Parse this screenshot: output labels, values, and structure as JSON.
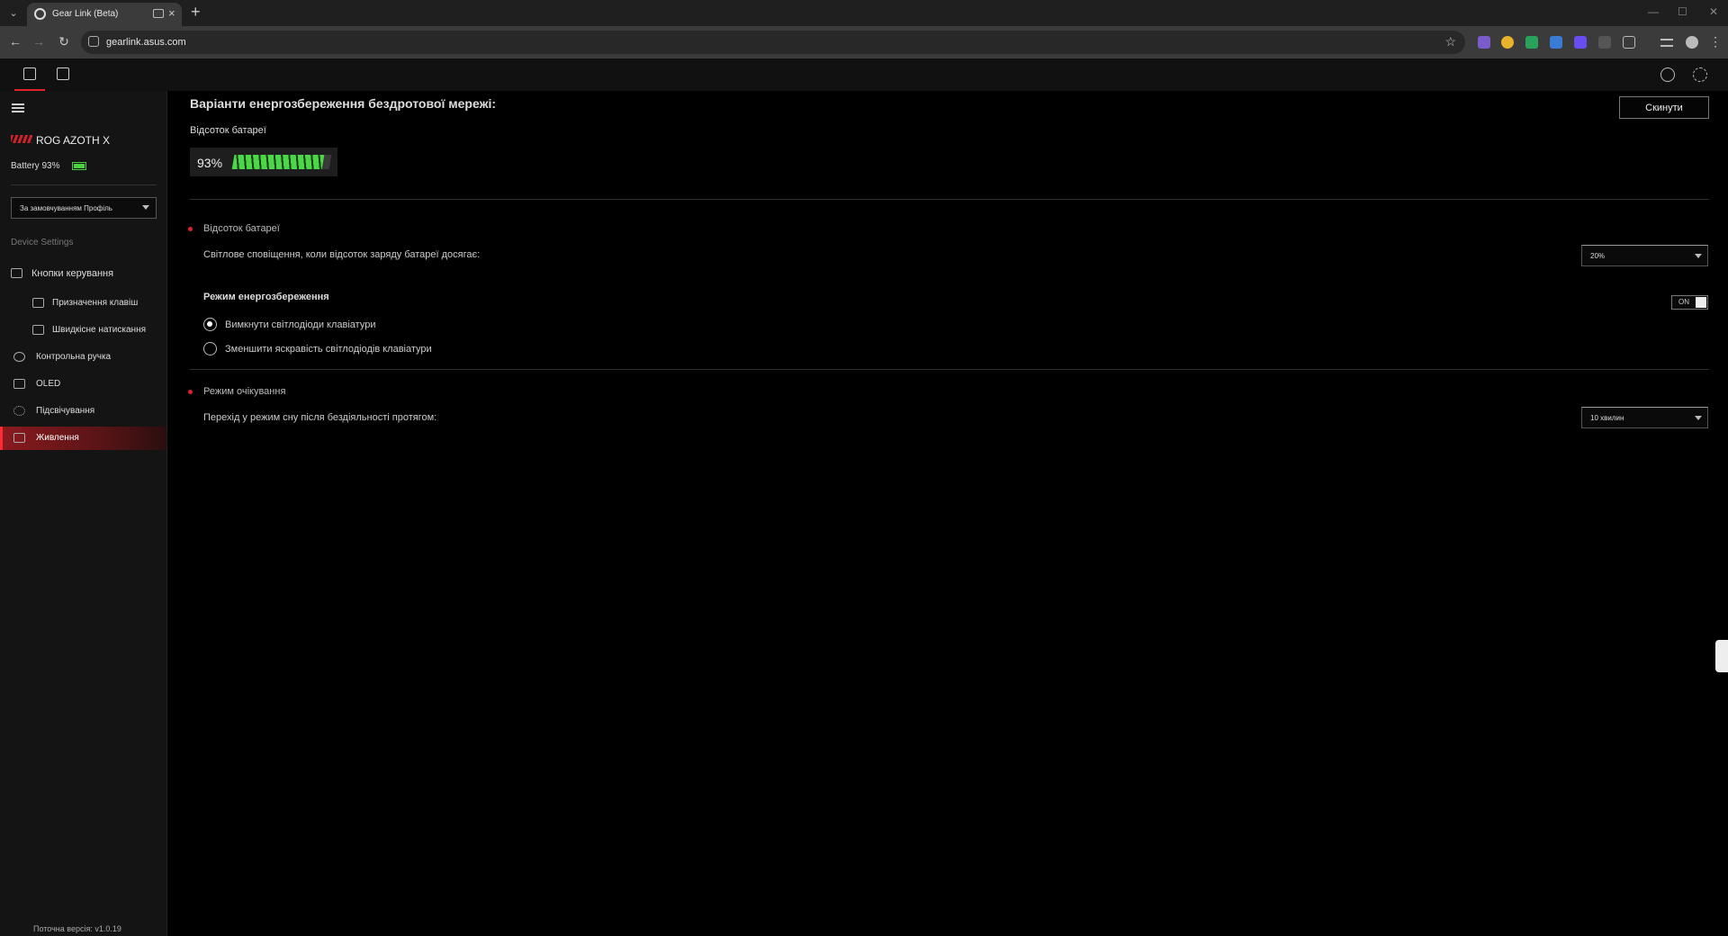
{
  "browser": {
    "tab_title": "Gear Link (Beta)",
    "url": "gearlink.asus.com"
  },
  "sidebar": {
    "device_name": "ROG AZOTH X",
    "battery_text": "Battery 93%",
    "profile": "За замовчуванням Профіль",
    "section_label": "Device Settings",
    "items": [
      {
        "label": "Кнопки керування",
        "icon": "keyboard-icon"
      },
      {
        "label": "Призначення клавіш",
        "icon": "key-mapping-icon"
      },
      {
        "label": "Швидкісне натискання",
        "icon": "rapid-press-icon"
      },
      {
        "label": "Контрольна ручка",
        "icon": "knob-icon"
      },
      {
        "label": "OLED",
        "icon": "oled-icon"
      },
      {
        "label": "Підсвічування",
        "icon": "lighting-icon"
      },
      {
        "label": "Живлення",
        "icon": "power-icon"
      }
    ],
    "version": "Поточна версія: v1.0.19"
  },
  "main": {
    "title": "Варіанти енергозбереження бездротової мережі:",
    "reset_label": "Скинути",
    "battery_section_title": "Відсоток батареї",
    "battery_percent_text": "93%",
    "battery_level": 0.93,
    "battery_alert": {
      "heading": "Відсоток батареї",
      "description": "Світлове сповіщення, коли відсоток заряду батареї досягає:",
      "value": "20%"
    },
    "power_saving": {
      "heading": "Режим енергозбереження",
      "toggle_label": "ON",
      "options": [
        {
          "label": "Вимкнути світлодіоди клавіатури",
          "checked": true
        },
        {
          "label": "Зменшити яскравість світлодіодів клавіатури",
          "checked": false
        }
      ]
    },
    "standby": {
      "heading": "Режим очікування",
      "description": "Перехід у режим сну після бездіяльності протягом:",
      "value": "10 хвилин"
    }
  },
  "colors": {
    "accent": "#e0202a",
    "battery_green": "#4ed64a"
  }
}
